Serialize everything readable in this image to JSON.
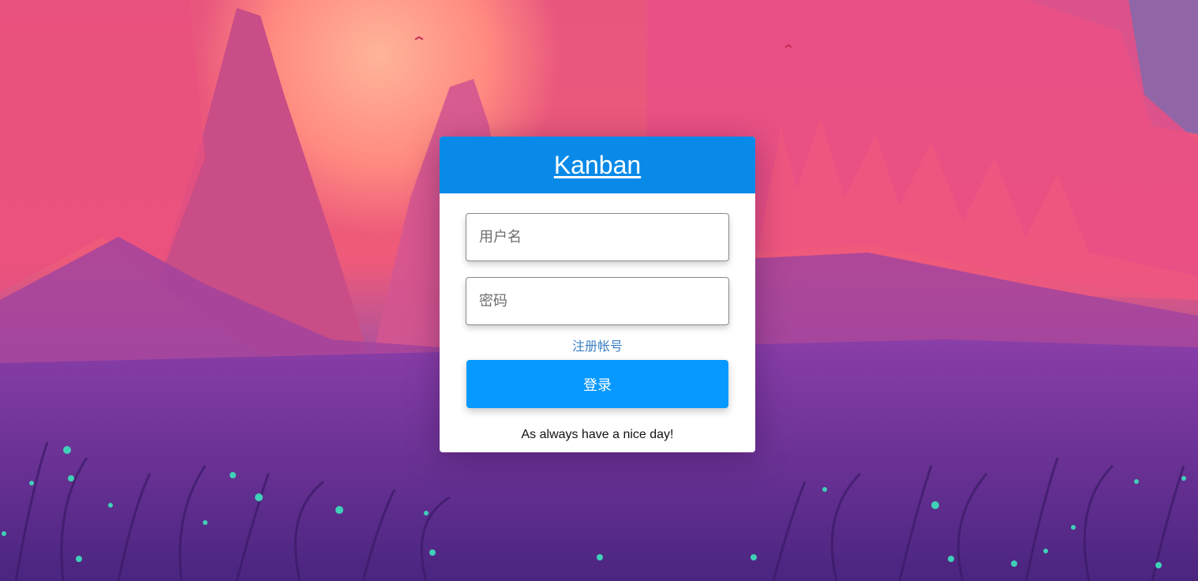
{
  "app": {
    "title": "Kanban"
  },
  "login_form": {
    "username_placeholder": "用户名",
    "password_placeholder": "密码",
    "register_link_label": "注册帐号",
    "login_button_label": "登录",
    "footer_message": "As always have a nice day!"
  },
  "colors": {
    "header_bg": "#0a8ae8",
    "button_bg": "#0799ff",
    "link": "#3a7fc4"
  },
  "background": {
    "description_icon": "landscape-illustration"
  }
}
